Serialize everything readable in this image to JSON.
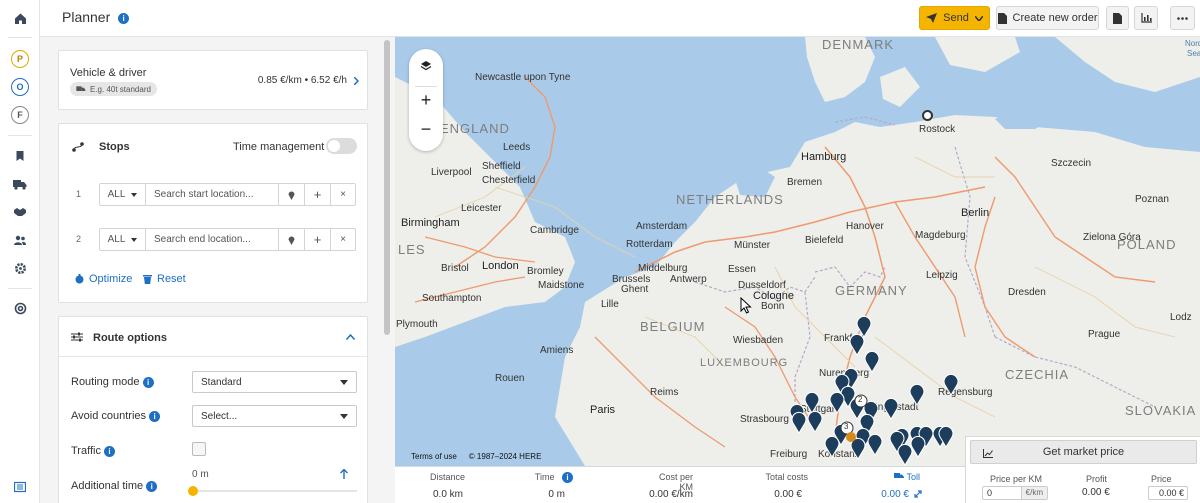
{
  "rail": {
    "letters": [
      "P",
      "O",
      "F"
    ]
  },
  "header": {
    "title": "Planner",
    "send_label": "Send",
    "create_order_label": "Create new order"
  },
  "vehicle": {
    "title": "Vehicle & driver",
    "badge": "E.g. 40t standard",
    "rate": "0.85 €/km • 6.52 €/h"
  },
  "stops": {
    "title": "Stops",
    "time_management_label": "Time management",
    "rows": [
      {
        "index": "1",
        "filter": "ALL",
        "placeholder": "Search start location..."
      },
      {
        "index": "2",
        "filter": "ALL",
        "placeholder": "Search end location..."
      }
    ],
    "optimize_label": "Optimize",
    "reset_label": "Reset"
  },
  "route_options": {
    "title": "Route options",
    "routing_mode_label": "Routing mode",
    "routing_mode_value": "Standard",
    "avoid_countries_label": "Avoid countries",
    "avoid_countries_value": "Select...",
    "traffic_label": "Traffic",
    "additional_time_label": "Additional time",
    "additional_time_value": "0 m"
  },
  "map": {
    "countries": [
      "DENMARK",
      "NETHERLANDS",
      "GERMANY",
      "BELGIUM",
      "LUXEMBOURG",
      "POLAND",
      "CZECHIA",
      "SLOVAKIA",
      "ENGLAND",
      "LES"
    ],
    "seas": [
      "Nord",
      "Sea",
      "Nord Sea"
    ],
    "cities": [
      "Newcastle upon Tyne",
      "Hamburg",
      "Rostock",
      "Szczecin",
      "Leeds",
      "Sheffield",
      "Liverpool",
      "Chesterfield",
      "Leicester",
      "Birmingham",
      "Cambridge",
      "London",
      "Bristol",
      "Bromley",
      "Southampton",
      "Maidstone",
      "Plymouth",
      "Amsterdam",
      "Rotterdam",
      "Bremen",
      "Hanover",
      "Berlin",
      "Magdeburg",
      "Bielefeld",
      "Münster",
      "Essen",
      "Dusseldorf",
      "Cologne",
      "Leipzig",
      "Dresden",
      "Frankfurt",
      "Wiesbaden",
      "Brussels",
      "Antwerp",
      "Ghent",
      "Lille",
      "Paris",
      "Reims",
      "Strasbourg",
      "Prague",
      "Lodz",
      "Zielona Góra",
      "Poznan",
      "Bonn",
      "Nuremberg",
      "Stuttgart",
      "Freiburg",
      "Konstanz",
      "Regensburg",
      "Ingolstadt",
      "Middelburg",
      "Amiens",
      "Rouen"
    ],
    "attribution_terms": "Terms of use",
    "attribution_copy": "© 1987–2024 HERE",
    "cluster_labels": [
      "2",
      "3"
    ]
  },
  "stats": {
    "distance_label": "Distance",
    "distance_value": "0.0 km",
    "time_label": "Time",
    "time_value": "0 m",
    "cost_per_km_label": "Cost per KM",
    "cost_per_km_value": "0.00 €/km",
    "total_costs_label": "Total costs",
    "total_costs_value": "0.00 €",
    "toll_label": "Toll",
    "toll_value": "0.00 €"
  },
  "market": {
    "button_label": "Get market price",
    "price_per_km_label": "Price per KM",
    "price_per_km_value": "0",
    "price_per_km_unit": "€/km",
    "profit_label": "Profit",
    "profit_value": "0.00 €",
    "price_label": "Price",
    "price_value": "0.00 €"
  },
  "colors": {
    "accent": "#1f6fc4",
    "send": "#f5b400",
    "pin": "#1c3d5c",
    "cluster": "#d68a1a"
  }
}
